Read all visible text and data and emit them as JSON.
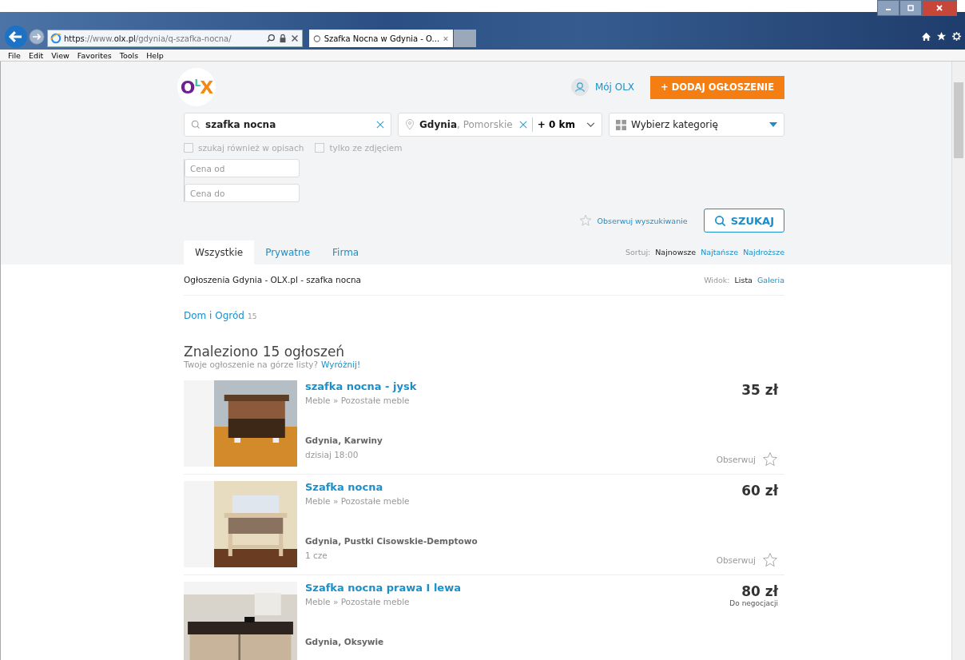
{
  "browser": {
    "url_scheme": "https",
    "url_prefix": "://www.",
    "url_domain": "olx.pl",
    "url_path": "/gdynia/q-szafka-nocna/",
    "tab_title": "Szafka Nocna w Gdynia - O...",
    "menu": [
      "File",
      "Edit",
      "View",
      "Favorites",
      "Tools",
      "Help"
    ]
  },
  "header": {
    "logo": "OLX",
    "account": "Mój OLX",
    "post_button": "+ DODAJ OGŁOSZENIE"
  },
  "search": {
    "query": "szafka nocna",
    "city": "Gdynia",
    "region": ", Pomorskie",
    "radius": "+ 0 km",
    "category_placeholder": "Wybierz kategorię",
    "options": [
      {
        "label": "szukaj również w opisach",
        "checked": false
      },
      {
        "label": "tylko ze zdjęciem",
        "checked": false
      }
    ],
    "price_from": {
      "placeholder": "Cena od"
    },
    "price_to": {
      "placeholder": "Cena do"
    },
    "watch": "Obserwuj wyszukiwanie",
    "submit": "SZUKAJ"
  },
  "tabs": [
    {
      "label": "Wszystkie",
      "selected": true
    },
    {
      "label": "Prywatne",
      "selected": false
    },
    {
      "label": "Firma",
      "selected": false
    }
  ],
  "sort": {
    "label": "Sortuj:",
    "options": [
      {
        "label": "Najnowsze",
        "selected": true
      },
      {
        "label": "Najtańsze",
        "selected": false
      },
      {
        "label": "Najdroższe",
        "selected": false
      }
    ]
  },
  "breadcrumb": "Ogłoszenia Gdynia - OLX.pl - szafka nocna",
  "view": {
    "label": "Widok:",
    "options": [
      {
        "label": "Lista",
        "selected": true
      },
      {
        "label": "Galeria",
        "selected": false
      }
    ]
  },
  "category": {
    "name": "Dom i Ogród",
    "count": "15"
  },
  "results": {
    "title": "Znaleziono 15 ogłoszeń",
    "promo": "Twoje ogłoszenie na górze listy?",
    "promo_link": "Wyróżnij!"
  },
  "listings": [
    {
      "title": "szafka nocna - jysk",
      "category": "Meble » Pozostałe meble",
      "price": "35 zł",
      "location": "Gdynia, Karwiny",
      "date": "dzisiaj 18:00",
      "watch": "Obserwuj",
      "kind": "picture"
    },
    {
      "title": "Szafka nocna",
      "category": "Meble » Pozostałe meble",
      "price": "60 zł",
      "location": "Gdynia, Pustki Cisowskie-Demptowo",
      "date": "1 cze",
      "watch": "Obserwuj",
      "kind": "picture"
    },
    {
      "title": "Szafka nocna prawa I lewa",
      "category": "Meble » Pozostałe meble",
      "price": "80 zł",
      "negotiable": "Do negocjacji",
      "location": "Gdynia, Oksywie",
      "kind": "picture"
    }
  ]
}
